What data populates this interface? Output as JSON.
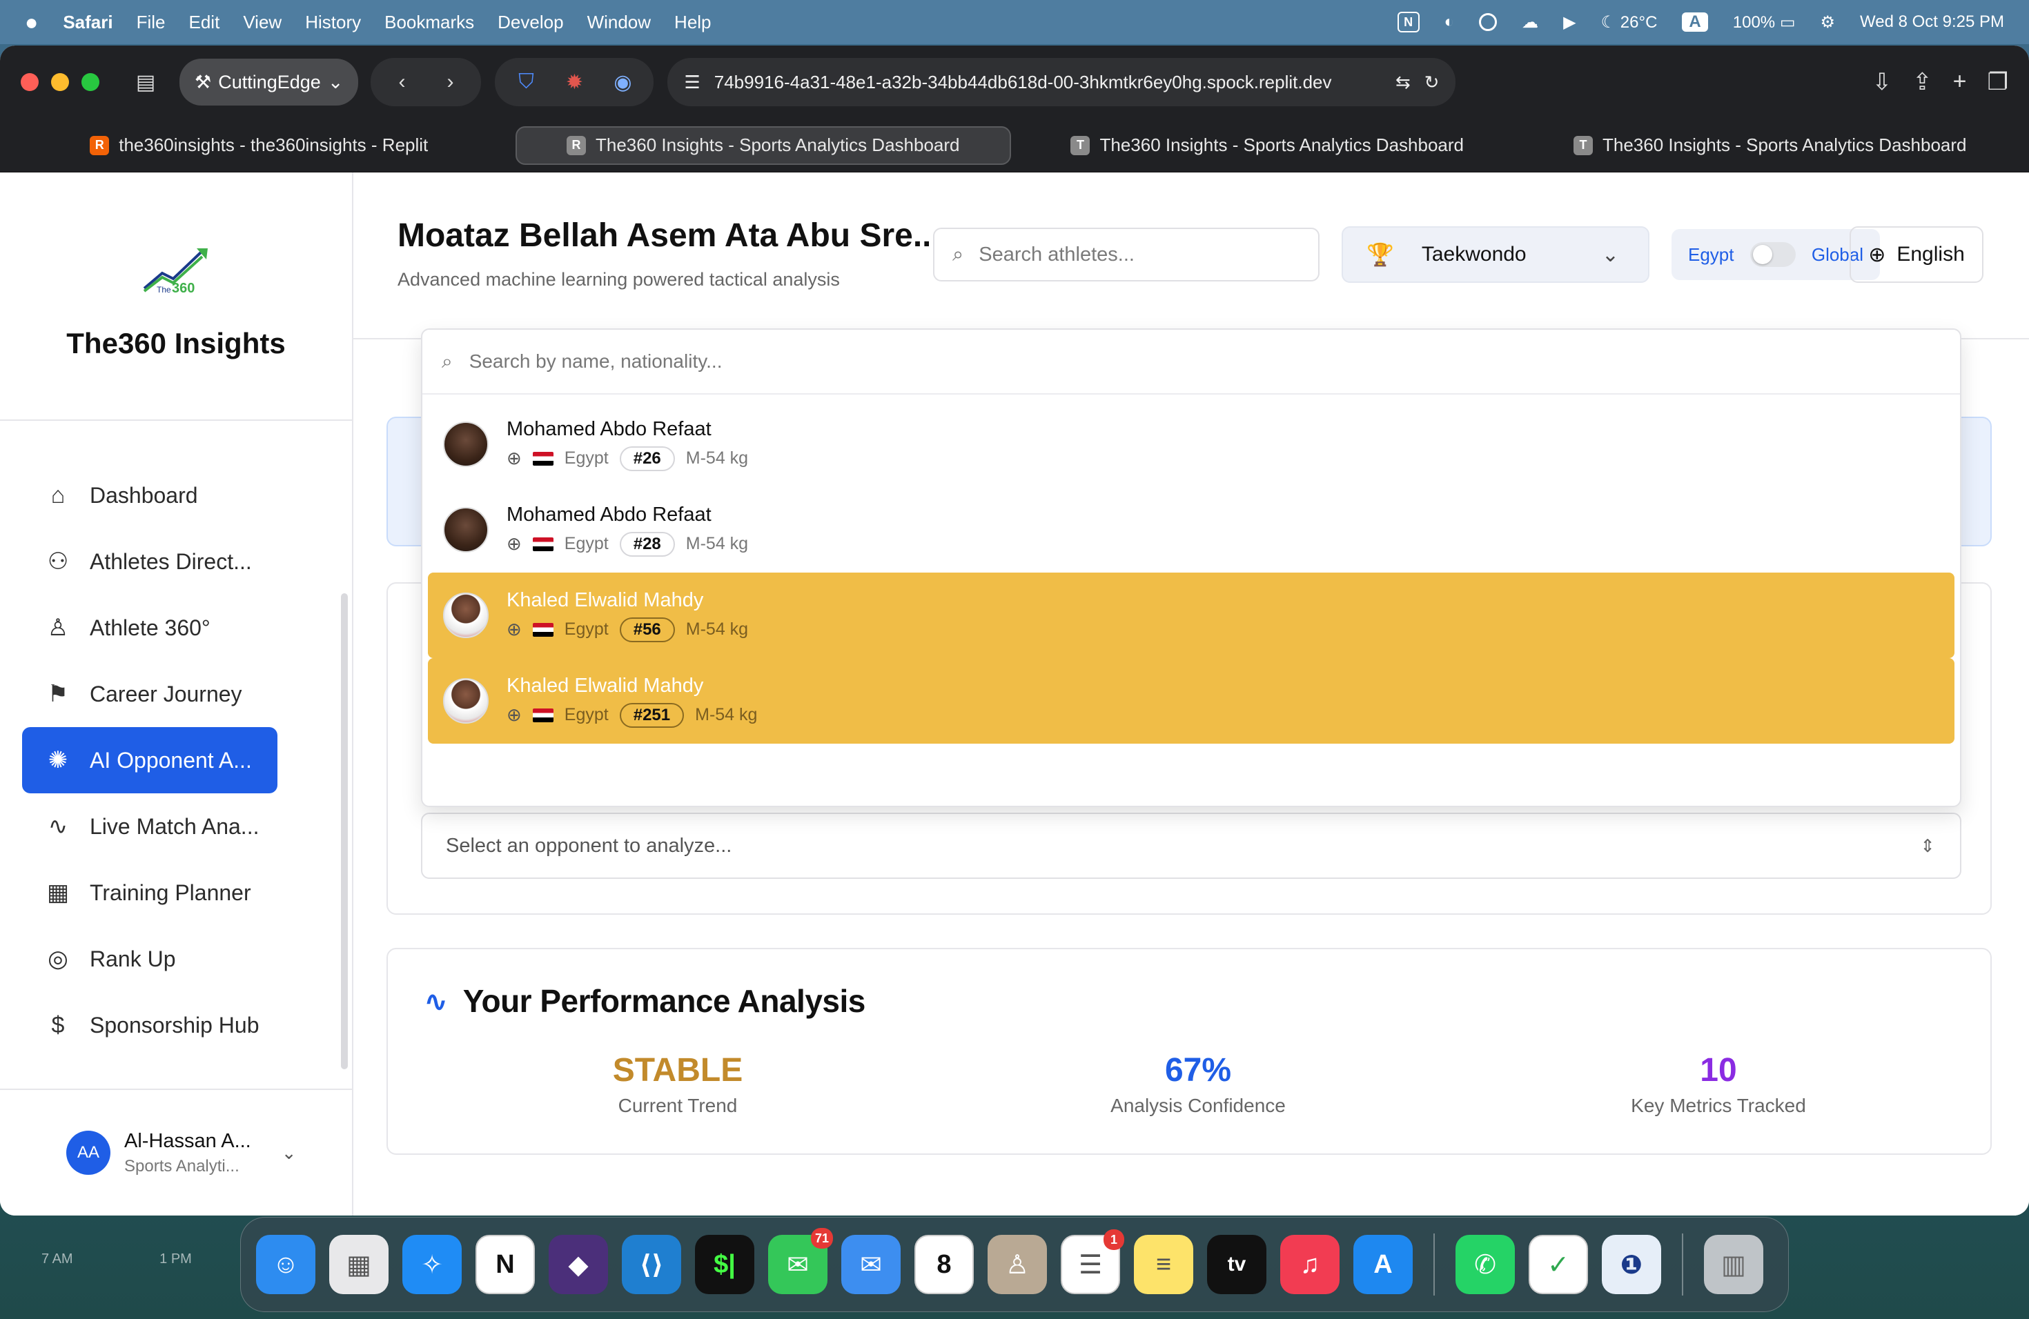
{
  "menubar": {
    "apple": "",
    "app": "Safari",
    "items": [
      "File",
      "Edit",
      "View",
      "History",
      "Bookmarks",
      "Develop",
      "Window",
      "Help"
    ],
    "status": {
      "n_icon": "N",
      "temp": "26°C",
      "input": "A",
      "battery": "100%",
      "datetime": "Wed 8 Oct  9:25 PM"
    }
  },
  "browser": {
    "profile": "CuttingEdge",
    "url": "74b9916-4a31-48e1-a32b-34bb44db618d-00-3hkmtkr6ey0hg.spock.replit.dev",
    "tabs": [
      {
        "icon": "R",
        "label": "the360insights - the360insights - Replit"
      },
      {
        "icon": "R",
        "label": "The360 Insights - Sports Analytics Dashboard"
      },
      {
        "icon": "T",
        "label": "The360 Insights - Sports Analytics Dashboard"
      },
      {
        "icon": "T",
        "label": "The360 Insights - Sports Analytics Dashboard"
      }
    ]
  },
  "sidebar": {
    "brand": "The360 Insights",
    "logo_text": "The360",
    "items": [
      {
        "label": "Dashboard",
        "icon": "home-icon",
        "glyph": "⌂"
      },
      {
        "label": "Athletes Direct...",
        "icon": "users-icon",
        "glyph": "👥"
      },
      {
        "label": "Athlete 360°",
        "icon": "user-icon",
        "glyph": "👤"
      },
      {
        "label": "Career Journey",
        "icon": "flag-icon",
        "glyph": "⚑"
      },
      {
        "label": "AI Opponent A...",
        "icon": "brain-icon",
        "glyph": "✺"
      },
      {
        "label": "Live Match Ana...",
        "icon": "activity-icon",
        "glyph": "∿"
      },
      {
        "label": "Training Planner",
        "icon": "calendar-icon",
        "glyph": "▦"
      },
      {
        "label": "Rank Up",
        "icon": "target-icon",
        "glyph": "◎"
      },
      {
        "label": "Sponsorship Hub",
        "icon": "dollar-icon",
        "glyph": "$"
      }
    ],
    "user": {
      "initials": "AA",
      "name": "Al-Hassan A...",
      "role": "Sports Analyti..."
    }
  },
  "header": {
    "title": "Moataz Bellah Asem Ata Abu Sre...",
    "subtitle": "Advanced machine learning powered tactical analysis",
    "search_placeholder": "Search athletes...",
    "sport": "Taekwondo",
    "toggle_left": "Egypt",
    "toggle_right": "Global",
    "language": "English"
  },
  "dropdown": {
    "search_placeholder": "Search by name, nationality...",
    "items": [
      {
        "name": "Mohamed Abdo Refaat",
        "country": "Egypt",
        "rank": "#26",
        "category": "M-54 kg",
        "highlighted": false
      },
      {
        "name": "Mohamed Abdo Refaat",
        "country": "Egypt",
        "rank": "#28",
        "category": "M-54 kg",
        "highlighted": false
      },
      {
        "name": "Khaled Elwalid Mahdy",
        "country": "Egypt",
        "rank": "#56",
        "category": "M-54 kg",
        "highlighted": true
      },
      {
        "name": "Khaled Elwalid Mahdy",
        "country": "Egypt",
        "rank": "#251",
        "category": "M-54 kg",
        "highlighted": true
      }
    ]
  },
  "opponent_select": {
    "placeholder": "Select an opponent to analyze..."
  },
  "performance": {
    "title": "Your Performance Analysis",
    "stats": [
      {
        "value": "STABLE",
        "label": "Current Trend",
        "color": "#c28a2b"
      },
      {
        "value": "67%",
        "label": "Analysis Confidence",
        "color": "#1f5ee6"
      },
      {
        "value": "10",
        "label": "Key Metrics Tracked",
        "color": "#8a2be2"
      }
    ]
  },
  "dock": {
    "widget_labels": [
      "7 AM",
      "1 PM"
    ],
    "apps": [
      {
        "name": "finder-icon",
        "glyph": "☺",
        "bg": "#2d8cf0"
      },
      {
        "name": "launchpad-icon",
        "glyph": "▦",
        "bg": "#e8e8ea"
      },
      {
        "name": "safari-icon",
        "glyph": "✧",
        "bg": "#1f8cf5"
      },
      {
        "name": "notion-icon",
        "glyph": "N",
        "bg": "#ffffff"
      },
      {
        "name": "obsidian-icon",
        "glyph": "◆",
        "bg": "#4b2f7a"
      },
      {
        "name": "vscode-icon",
        "glyph": "⟨⟩",
        "bg": "#1f7fd0"
      },
      {
        "name": "terminal-icon",
        "glyph": "$|",
        "bg": "#111111"
      },
      {
        "name": "messages-icon",
        "glyph": "💬",
        "bg": "#34c759",
        "badge": "71"
      },
      {
        "name": "mail-icon",
        "glyph": "✉",
        "bg": "#3d8ef0"
      },
      {
        "name": "calendar-icon",
        "glyph": "8",
        "bg": "#ffffff"
      },
      {
        "name": "contacts-icon",
        "glyph": "👤",
        "bg": "#b9a994"
      },
      {
        "name": "reminders-icon",
        "glyph": "☰",
        "bg": "#ffffff",
        "badge": "1"
      },
      {
        "name": "notes-icon",
        "glyph": "≡",
        "bg": "#fde36a"
      },
      {
        "name": "appletv-icon",
        "glyph": "tv",
        "bg": "#111111"
      },
      {
        "name": "music-icon",
        "glyph": "♫",
        "bg": "#f23c52"
      },
      {
        "name": "appstore-icon",
        "glyph": "A",
        "bg": "#1e88f0"
      },
      {
        "name": "whatsapp-icon",
        "glyph": "✆",
        "bg": "#25d366"
      },
      {
        "name": "adguard-icon",
        "glyph": "✓",
        "bg": "#ffffff"
      },
      {
        "name": "1password-icon",
        "glyph": "❶",
        "bg": "#e6eef8"
      },
      {
        "name": "trash-icon",
        "glyph": "🗑",
        "bg": "#bfc4c8"
      }
    ]
  }
}
